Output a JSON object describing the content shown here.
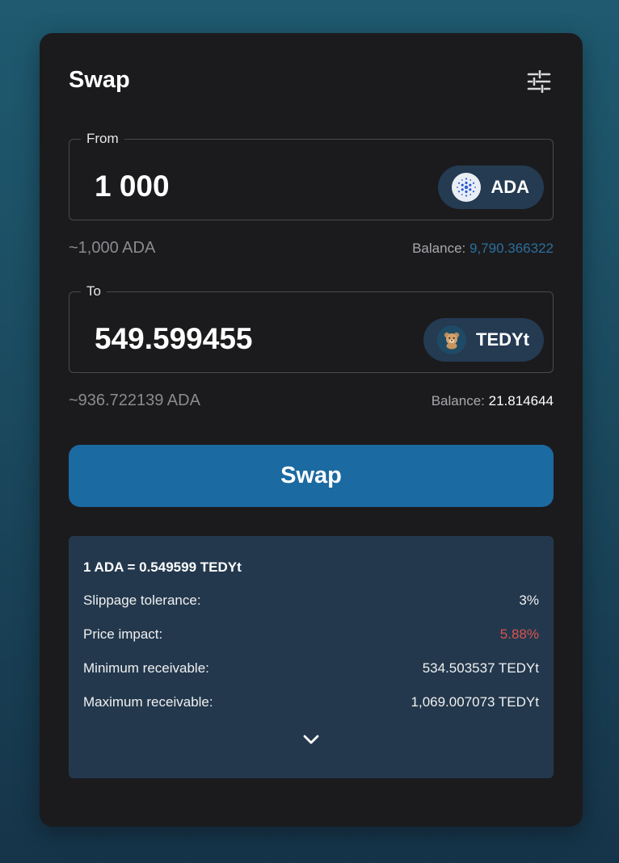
{
  "header": {
    "title": "Swap"
  },
  "from": {
    "legend": "From",
    "amount": "1 000",
    "token": "ADA",
    "approx": "~1,000 ADA",
    "balance_label": "Balance:",
    "balance_value": "9,790.366322"
  },
  "to": {
    "legend": "To",
    "amount": "549.599455",
    "token": "TEDYt",
    "approx": "~936.722139 ADA",
    "balance_label": "Balance:",
    "balance_value": "21.814644"
  },
  "swap_button": "Swap",
  "details": {
    "rate": "1 ADA = 0.549599 TEDYt",
    "rows": [
      {
        "label": "Slippage tolerance:",
        "value": "3%"
      },
      {
        "label": "Price impact:",
        "value": "5.88%"
      },
      {
        "label": "Minimum receivable:",
        "value": "534.503537 TEDYt"
      },
      {
        "label": "Maximum receivable:",
        "value": "1,069.007073 TEDYt"
      }
    ]
  },
  "colors": {
    "accent": "#1b6aa1",
    "balance_link": "#2c6e9e",
    "price_impact": "#d9534f",
    "card": "#1b1b1d",
    "panel": "#23384d"
  },
  "icons": [
    "sliders-settings-icon",
    "cardano-ada-icon",
    "teddy-bear-token-icon",
    "chevron-down-icon"
  ]
}
